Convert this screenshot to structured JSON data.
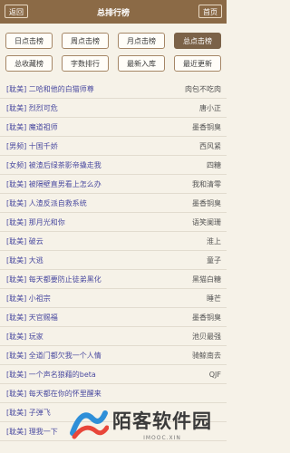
{
  "header": {
    "title": "总排行榜",
    "back": "返回",
    "home": "首页"
  },
  "tabs": [
    [
      {
        "label": "日点击榜",
        "active": false
      },
      {
        "label": "周点击榜",
        "active": false
      },
      {
        "label": "月点击榜",
        "active": false
      },
      {
        "label": "总点击榜",
        "active": true
      }
    ],
    [
      {
        "label": "总收藏榜",
        "active": false
      },
      {
        "label": "字数排行",
        "active": false
      },
      {
        "label": "最新入库",
        "active": false
      },
      {
        "label": "最近更新",
        "active": false
      }
    ]
  ],
  "books": [
    {
      "title": "[耽美] 二哈和他的白猫师尊",
      "author": "肉包不吃肉"
    },
    {
      "title": "[耽美] 烈烈可危",
      "author": "唐小正"
    },
    {
      "title": "[耽美] 魔道祖师",
      "author": "墨香铜臭"
    },
    {
      "title": "[男频] 十国千娇",
      "author": "西风紧"
    },
    {
      "title": "[女频] 被渣后绿茶影帝撬走我",
      "author": "四糖"
    },
    {
      "title": "[耽美] 被隔壁直男看上怎么办",
      "author": "我和清零"
    },
    {
      "title": "[耽美] 人渣反派自救系统",
      "author": "墨香铜臭"
    },
    {
      "title": "[耽美] 那月光和你",
      "author": "语笑阑珊"
    },
    {
      "title": "[耽美] 破云",
      "author": "淮上"
    },
    {
      "title": "[耽美] 大逃",
      "author": "童子"
    },
    {
      "title": "[耽美] 每天都要防止徒弟黑化",
      "author": "黑猫白糖"
    },
    {
      "title": "[耽美] 小祖宗",
      "author": "睡芒"
    },
    {
      "title": "[耽美] 天官赐福",
      "author": "墨香铜臭"
    },
    {
      "title": "[耽美] 玩家",
      "author": "池贝最强"
    },
    {
      "title": "[耽美] 全道门都欠我一个人情",
      "author": "骑鲸南去"
    },
    {
      "title": "[耽美] 一个声名狼藉的beta",
      "author": "QJF"
    },
    {
      "title": "[耽美] 每天都在你的怀里醒来",
      "author": ""
    },
    {
      "title": "[耽美] 子弹飞",
      "author": ""
    },
    {
      "title": "[耽美] 理我一下",
      "author": ""
    }
  ],
  "watermark": {
    "name": "陌客软件园",
    "domain": "IMOOC.XIN"
  },
  "colors": {
    "header": "#8b6a46",
    "active_tab": "#7b6248",
    "title_link": "#4a4aa0"
  }
}
